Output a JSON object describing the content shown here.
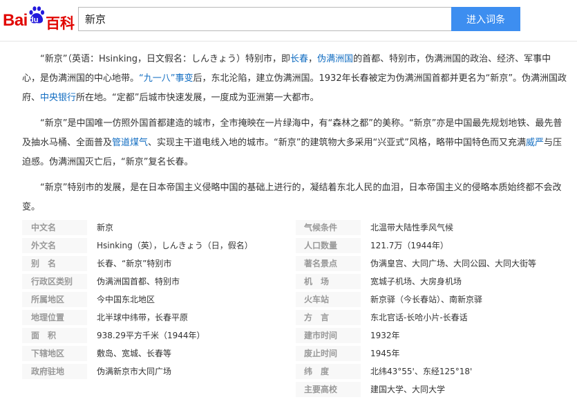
{
  "logo": {
    "bai": "Bai",
    "du": "du",
    "baike": "百科"
  },
  "search": {
    "query": "新京",
    "button_label": "进入词条"
  },
  "paragraphs": [
    [
      {
        "t": "“新京”（英语：Hsinking，日文假名：しんきょう）特别市，即"
      },
      {
        "t": "长春",
        "link": true
      },
      {
        "t": "，"
      },
      {
        "t": "伪满洲国",
        "link": true
      },
      {
        "t": "的首都、特别市，伪满洲国的政治、经济、军事中心，是伪满洲国的中心地带。"
      },
      {
        "t": "“九一八”事变",
        "link": true
      },
      {
        "t": "后，东北沦陷，建立伪满洲国。1932年长春被定为伪满洲国首都并更名为“新京”。伪满洲国政府、"
      },
      {
        "t": "中央银行",
        "link": true
      },
      {
        "t": "所在地。“定都”后城市快速发展，一度成为亚洲第一大都市。"
      }
    ],
    [
      {
        "t": "“新京”是中国唯一仿照外国首都建造的城市，全市掩映在一片绿海中，有“森林之都”的美称。“新京”亦是中国最先规划地铁、最先普及抽水马桶、全面普及"
      },
      {
        "t": "管道煤气",
        "link": true
      },
      {
        "t": "、实现主干道电线入地的城市。“新京”的建筑物大多采用“兴亚式”风格，略带中国特色而又充满"
      },
      {
        "t": "威严",
        "link": true
      },
      {
        "t": "与压迫感。伪满洲国灭亡后，“新京”复名长春。"
      }
    ],
    [
      {
        "t": "“新京”特别市的发展，是在日本帝国主义侵略中国的基础上进行的，凝结着东北人民的血泪，日本帝国主义的侵略本质始终都不会改变。"
      }
    ]
  ],
  "info_left": [
    {
      "key": "中文名",
      "value": "新京"
    },
    {
      "key": "外文名",
      "value": "Hsinking（英），しんきょう（日，假名）"
    },
    {
      "key": "别　名",
      "value": "长春、“新京”特别市"
    },
    {
      "key": "行政区类别",
      "value": "伪满洲国首都、特别市"
    },
    {
      "key": "所属地区",
      "value": "今中国东北地区"
    },
    {
      "key": "地理位置",
      "value": "北半球中纬带，长春平原"
    },
    {
      "key": "面　积",
      "value": "938.29平方千米（1944年）"
    },
    {
      "key": "下辖地区",
      "value": "敷岛、宽城、长春等"
    },
    {
      "key": "政府驻地",
      "value": "伪满新京市大同广场"
    }
  ],
  "info_right": [
    {
      "key": "气候条件",
      "value": "北温带大陆性季风气候"
    },
    {
      "key": "人口数量",
      "value": "121.7万（1944年）"
    },
    {
      "key": "著名景点",
      "value": "伪满皇宫、大同广场、大同公园、大同大街等"
    },
    {
      "key": "机　场",
      "value": "宽城子机场、大房身机场"
    },
    {
      "key": "火车站",
      "value": "新京驿（今长春站）、南新京驿"
    },
    {
      "key": "方　言",
      "value": "东北官话-长哈小片-长春话"
    },
    {
      "key": "建市时间",
      "value": "1932年"
    },
    {
      "key": "废止时间",
      "value": "1945年"
    },
    {
      "key": "纬　度",
      "value": "北纬43°55'、东经125°18'"
    },
    {
      "key": "主要高校",
      "value": "建国大学、大同大学"
    }
  ],
  "colors": {
    "brand_red": "#e10602",
    "brand_blue": "#2319dc",
    "button_blue": "#3d8ef0",
    "link_blue": "#136ec2",
    "key_gray": "#999999"
  }
}
